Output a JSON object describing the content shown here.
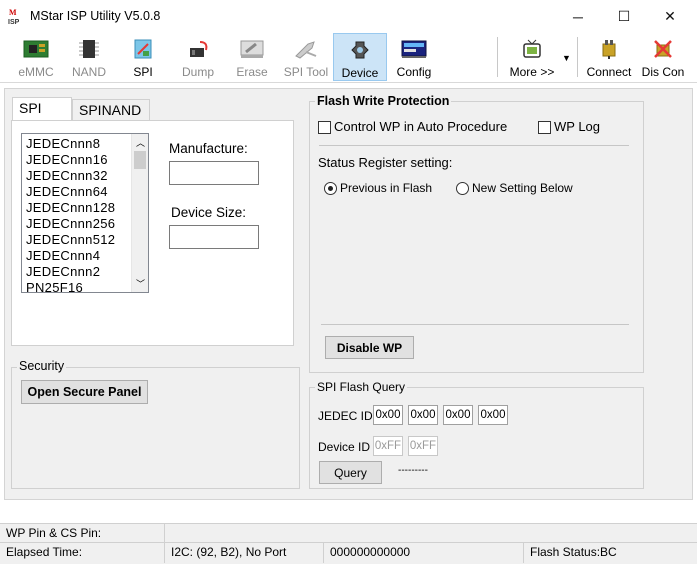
{
  "window": {
    "title": "MStar ISP Utility V5.0.8",
    "minimize": "─",
    "maximize": "☐",
    "close": "✕"
  },
  "toolbar": {
    "items": [
      {
        "label": "eMMC",
        "icon": "emmc-chip-icon",
        "enabled": false
      },
      {
        "label": "NAND",
        "icon": "nand-chip-icon",
        "enabled": false
      },
      {
        "label": "SPI",
        "icon": "spi-chip-icon",
        "enabled": true
      },
      {
        "label": "Dump",
        "icon": "dump-icon",
        "enabled": false
      },
      {
        "label": "Erase",
        "icon": "erase-icon",
        "enabled": false
      },
      {
        "label": "SPI Tool",
        "icon": "spi-tool-icon",
        "enabled": false
      },
      {
        "label": "Device",
        "icon": "device-icon",
        "enabled": true,
        "active": true
      },
      {
        "label": "Config",
        "icon": "config-icon",
        "enabled": true
      }
    ],
    "more_label": "More >>",
    "connect_label": "Connect",
    "disconnect_label": "Dis Con"
  },
  "tabs": {
    "spi": "SPI",
    "spinand": "SPINAND"
  },
  "device_list": {
    "items": [
      "JEDECnnn8",
      "JEDECnnn16",
      "JEDECnnn32",
      "JEDECnnn64",
      "JEDECnnn128",
      "JEDECnnn256",
      "JEDECnnn512",
      "JEDECnnn4",
      "JEDECnnn2",
      "PN25F16"
    ]
  },
  "fields": {
    "manufacture_label": "Manufacture:",
    "manufacture_value": "",
    "device_size_label": "Device Size:",
    "device_size_value": ""
  },
  "security": {
    "title": "Security",
    "open_panel": "Open Secure Panel"
  },
  "flash_wp": {
    "title": "Flash Write Protection",
    "control_wp": "Control WP in Auto Procedure",
    "wp_log": "WP Log",
    "status_register": "Status Register setting:",
    "previous_in_flash": "Previous in Flash",
    "new_setting_below": "New Setting Below",
    "disable_wp": "Disable WP"
  },
  "spi_query": {
    "title": "SPI Flash Query",
    "jedec_id_label": "JEDEC ID",
    "jedec_ids": [
      "0x00",
      "0x00",
      "0x00",
      "0x00"
    ],
    "device_id_label": "Device ID",
    "device_ids": [
      "0xFF",
      "0xFF"
    ],
    "query_button": "Query",
    "result": "---------"
  },
  "status": {
    "wp_cs_pin": "WP Pin & CS Pin:",
    "elapsed_time": "Elapsed Time:",
    "i2c": "I2C: (92, B2), No Port",
    "counter": "000000000000",
    "flash_status": "Flash Status:BC"
  }
}
